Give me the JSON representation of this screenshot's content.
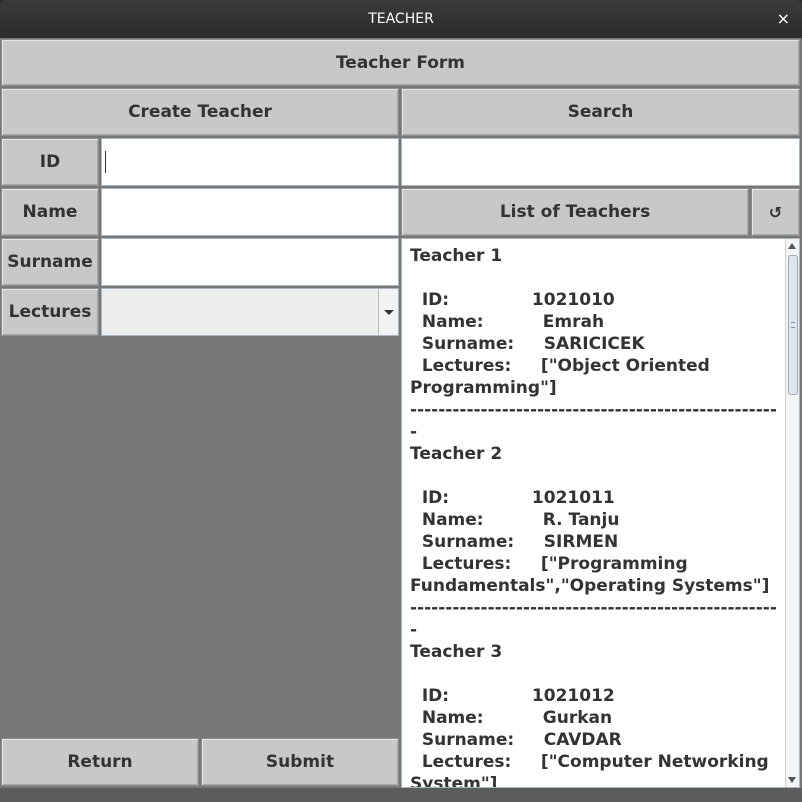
{
  "window": {
    "title": "TEACHER",
    "close_glyph": "×"
  },
  "form": {
    "header": "Teacher Form",
    "create_label": "Create Teacher",
    "search_label": "Search",
    "id_label": "ID",
    "name_label": "Name",
    "surname_label": "Surname",
    "lectures_label": "Lectures",
    "id_value": "",
    "name_value": "",
    "surname_value": "",
    "lectures_selected": "",
    "search_value": "",
    "list_label": "List of Teachers",
    "refresh_glyph": "↺",
    "refresh_icon": "refresh-icon",
    "return_label": "Return",
    "submit_label": "Submit"
  },
  "teachers_list": {
    "text": "Teacher 1\n\n  ID:              1021010\n  Name:          Emrah\n  Surname:     SARICICEK\n  Lectures:     [\"Object Oriented Programming\"]\n-----------------------------------------------------\nTeacher 2\n\n  ID:              1021011\n  Name:          R. Tanju\n  Surname:     SIRMEN\n  Lectures:     [\"Programming Fundamentals\",\"Operating Systems\"]\n-----------------------------------------------------\nTeacher 3\n\n  ID:              1021012\n  Name:          Gurkan\n  Surname:     CAVDAR\n  Lectures:     [\"Computer Networking System\"]\n-----------------------------------------------------"
  }
}
